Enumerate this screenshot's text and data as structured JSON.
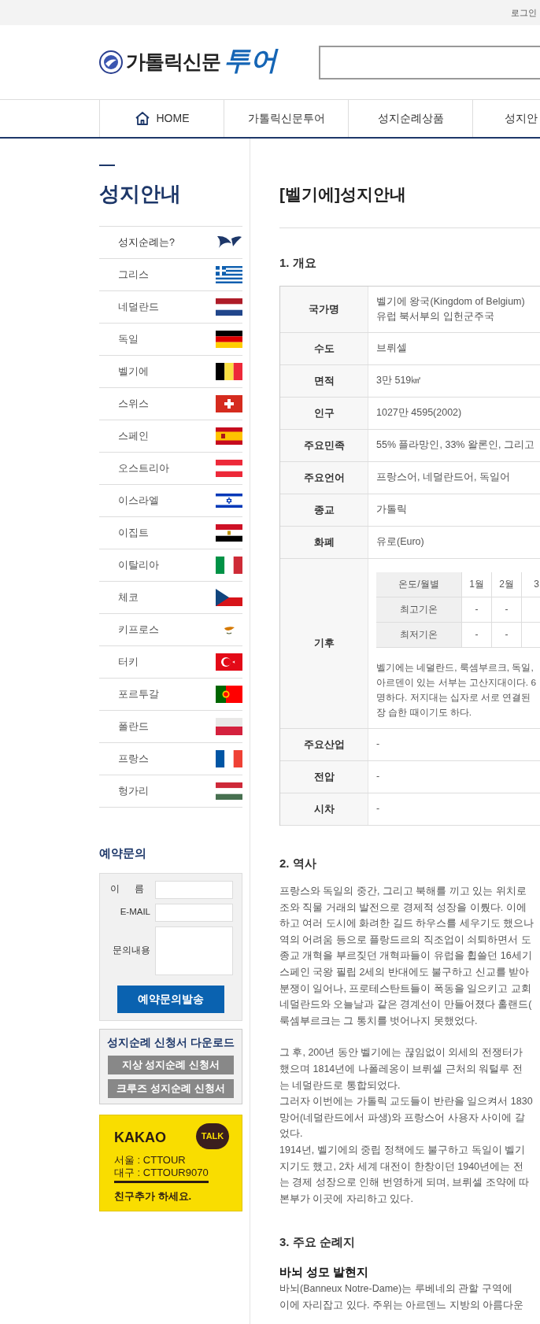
{
  "top_bar": {
    "login": "로그인"
  },
  "header": {
    "logo_text": "가톨릭신문",
    "logo_accent": "투어"
  },
  "nav": [
    {
      "label": "HOME",
      "kind": "home"
    },
    {
      "label": "가톨릭신문투어",
      "kind": "text"
    },
    {
      "label": "성지순례상품",
      "kind": "text"
    },
    {
      "label": "성지안",
      "kind": "text"
    }
  ],
  "sidebar": {
    "title": "성지안내",
    "items": [
      {
        "label": "성지순례는?"
      },
      {
        "label": "그리스"
      },
      {
        "label": "네덜란드"
      },
      {
        "label": "독일"
      },
      {
        "label": "벨기에"
      },
      {
        "label": "스위스"
      },
      {
        "label": "스페인"
      },
      {
        "label": "오스트리아"
      },
      {
        "label": "이스라엘"
      },
      {
        "label": "이집트"
      },
      {
        "label": "이탈리아"
      },
      {
        "label": "체코"
      },
      {
        "label": "키프로스"
      },
      {
        "label": "터키"
      },
      {
        "label": "포르투갈"
      },
      {
        "label": "폴란드"
      },
      {
        "label": "프랑스"
      },
      {
        "label": "헝가리"
      }
    ]
  },
  "inquiry": {
    "title": "예약문의",
    "fields": [
      {
        "label": "이 름",
        "kind": "input"
      },
      {
        "label": "E-MAIL",
        "kind": "input"
      },
      {
        "label": "문의내용",
        "kind": "textarea"
      }
    ],
    "submit": "예약문의발송"
  },
  "download": {
    "title": "성지순례 신청서 다운로드",
    "buttons": [
      "지상 성지순례 신청서",
      "크루즈 성지순례 신청서"
    ]
  },
  "kakao": {
    "title": "KAKAO",
    "badge": "TALK",
    "lines": [
      "서울 : CTTOUR",
      "대구 : CTTOUR9070"
    ],
    "note": "친구추가 하세요."
  },
  "content": {
    "title": "[벨기에]성지안내",
    "sections": [
      {
        "heading": "1. 개요",
        "kind": "table",
        "rows": [
          {
            "label": "국가명",
            "lines": [
              "벨기에 왕국(Kingdom of Belgium)",
              "유럽 북서부의 입헌군주국"
            ]
          },
          {
            "label": "수도",
            "lines": [
              "브뤼셀"
            ]
          },
          {
            "label": "면적",
            "lines": [
              "3만 519㎢"
            ]
          },
          {
            "label": "인구",
            "lines": [
              "1027만 4595(2002)"
            ]
          },
          {
            "label": "주요민족",
            "lines": [
              "55% 플라망인, 33% 왈론인, 그리고"
            ]
          },
          {
            "label": "주요언어",
            "lines": [
              "프랑스어, 네덜란드어, 독일어"
            ]
          },
          {
            "label": "종교",
            "lines": [
              "가톨릭"
            ]
          },
          {
            "label": "화폐",
            "lines": [
              "유로(Euro)"
            ]
          },
          {
            "label": "기후",
            "climate": {
              "header": [
                "온도/월별",
                "1월",
                "2월",
                "3"
              ],
              "rows": [
                [
                  "최고기온",
                  "-",
                  "-"
                ],
                [
                  "최저기온",
                  "-",
                  "-"
                ]
              ]
            },
            "lines": [
              "벨기에는 네덜란드, 룩셈부르크, 독일,",
              "아르덴이 있는 서부는 고산지대이다. 6",
              "명하다. 저지대는 십자로 서로 연결된",
              "장 습한 때이기도 하다."
            ]
          },
          {
            "label": "주요산업",
            "lines": [
              "-"
            ]
          },
          {
            "label": "전압",
            "lines": [
              "-"
            ]
          },
          {
            "label": "시차",
            "lines": [
              "-"
            ]
          }
        ]
      },
      {
        "heading": "2. 역사",
        "kind": "text",
        "paragraphs": [
          [
            "프랑스와 독일의 중간, 그리고 북해를 끼고 있는 위치로",
            "조와 직물 거래의 발전으로 경제적 성장을 이뤘다. 이에",
            "하고 여러 도시에 화려한 길드 하우스를 세우기도 했으나",
            "역의 어려움 등으로 플랑드르의 직조업이 쇠퇴하면서 도",
            "종교 개혁을 부르짖던 개혁파들이 유럽을 휩쓸던 16세기",
            "스페인 국왕 필립 2세의 반대에도 불구하고 신교를 받아",
            "분쟁이 일어나, 프로테스탄트들이 폭동을 일으키고 교회",
            "네덜란드와 오늘날과 같은 경계선이 만들어졌다 홀랜드(",
            "룩셈부르크는 그 통치를 벗어나지 못했었다."
          ],
          [
            "그 후, 200년 동안 벨기에는 끊임없이 외세의 전쟁터가",
            "했으며 1814년에 나폴레옹이 브뤼셀 근처의 워털루 전",
            "는 네덜란드로 통합되었다.",
            "그러자 이번에는 가톨릭 교도들이 반란을 일으켜서 1830",
            "망어(네덜란드에서 파생)와 프랑스어 사용자 사이에 갈",
            "었다.",
            "1914년, 벨기에의 중립 정책에도 불구하고 독일이 벨기",
            "지기도 했고, 2차 세계 대전이 한창이던 1940년에는 전",
            "는 경제 성장으로 인해 번영하게 되며, 브뤼셀 조약에 따",
            "본부가 이곳에 자리하고 있다."
          ]
        ]
      },
      {
        "heading": "3. 주요 순례지",
        "kind": "sites",
        "sites": [
          {
            "name": "바뇌 성모 발현지",
            "lines": [
              "바뇌(Banneux Notre-Dame)는 루베네의 관할 구역에",
              "이에 자리잡고 있다. 주위는 아르덴느 지방의 아름다운"
            ]
          }
        ]
      }
    ]
  }
}
